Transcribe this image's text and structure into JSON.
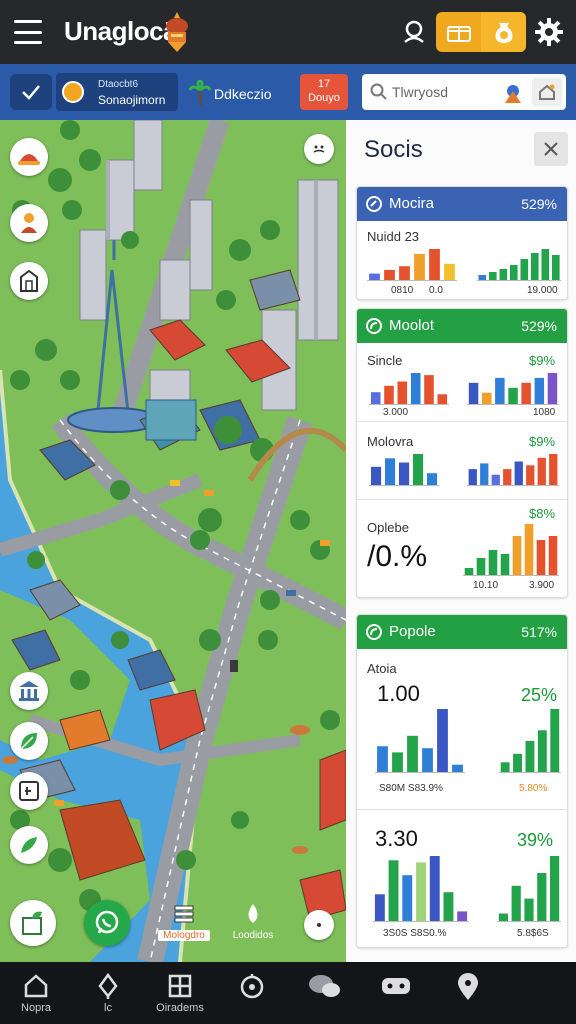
{
  "app": {
    "title": "Unaglocä"
  },
  "subbar": {
    "city_small": "Dtaocbt6",
    "city_name": "Sonaojimorn",
    "label": "Ddkeczio",
    "badge_line1": "17",
    "badge_line2": "Douyo"
  },
  "search": {
    "value": "Tlwryosd"
  },
  "map": {
    "chip1_label": "Mologdro",
    "chip2_label": "Loodidos"
  },
  "panel": {
    "title": "Socis",
    "cards": [
      {
        "name": "Mocira",
        "percent": "529%",
        "header_color": "#3a63b3",
        "rows": [
          {
            "label": "Nuidd 23",
            "axis_left": [
              "0810",
              "0.0"
            ],
            "axis_right": "19.000",
            "chart_left": [
              6,
              9,
              12,
              22,
              26,
              14
            ],
            "colors_left": [
              "#5b6ee1",
              "#e5532e",
              "#e5532e",
              "#f0a02a",
              "#e5532e",
              "#f0c02a"
            ],
            "chart_right": [
              6,
              9,
              12,
              16,
              22,
              28,
              32,
              26
            ],
            "colors_right": [
              "#2f7fd8",
              "#23a44b",
              "#23a44b",
              "#23a44b",
              "#23a44b",
              "#23a44b",
              "#23a44b",
              "#23a44b"
            ]
          }
        ]
      },
      {
        "name": "Moolot",
        "percent": "529%",
        "header_color": "#23a043",
        "rows": [
          {
            "label": "Sincle",
            "pct": "$9%",
            "axis_left": "3.000",
            "axis_right": "1080",
            "chart_left": [
              12,
              18,
              22,
              30,
              28,
              10
            ],
            "colors_left": [
              "#5b6ee1",
              "#e5532e",
              "#e5532e",
              "#2f7fd8",
              "#e5532e",
              "#e5532e"
            ],
            "chart_right": [
              18,
              10,
              22,
              14,
              18,
              22,
              26
            ],
            "colors_right": [
              "#3a57c4",
              "#f0a02a",
              "#2f7fd8",
              "#23a44b",
              "#e5532e",
              "#2f7fd8",
              "#7a55c9"
            ]
          },
          {
            "label": "Molovra",
            "pct": "$9%",
            "chart_left": [
              18,
              26,
              22,
              30,
              12
            ],
            "colors_left": [
              "#3a57c4",
              "#2f7fd8",
              "#3a57c4",
              "#23a44b",
              "#2f7fd8"
            ],
            "chart_right": [
              18,
              24,
              12,
              18,
              26,
              22,
              30,
              34
            ],
            "colors_right": [
              "#3a57c4",
              "#2f7fd8",
              "#5b6ee1",
              "#e5532e",
              "#3a57c4",
              "#e5532e",
              "#e5532e",
              "#e5532e"
            ]
          },
          {
            "label": "Oplebe",
            "pct": "$8%",
            "big": "/0.%",
            "axis_left": "10.10",
            "axis_right": "3.900",
            "chart_right": [
              8,
              18,
              26,
              22,
              40,
              52,
              36,
              40
            ],
            "colors_right": [
              "#23a44b",
              "#23a44b",
              "#23a44b",
              "#23a44b",
              "#f0a02a",
              "#f0a02a",
              "#e5532e",
              "#e5532e"
            ]
          }
        ]
      },
      {
        "name": "Popole",
        "percent": "517%",
        "header_color": "#23a043",
        "rows": [
          {
            "label": "Atoia",
            "big": "1.00",
            "pct": "25%",
            "axis_left": "S80M  S83.9%",
            "axis_right": "5.80%",
            "chart_left": [
              26,
              20,
              36,
              24,
              62,
              8
            ],
            "colors_left": [
              "#2f7fd8",
              "#23a44b",
              "#23a44b",
              "#2f7fd8",
              "#3a57c4",
              "#2f7fd8"
            ],
            "chart_right": [
              10,
              18,
              30,
              40,
              60
            ],
            "colors_right": [
              "#23a44b",
              "#23a44b",
              "#23a44b",
              "#23a44b",
              "#23a44b"
            ]
          },
          {
            "big": "3.30",
            "pct": "39%",
            "axis_left": "3S0S  S8S0.%",
            "axis_right": "5.8$6S",
            "chart_left": [
              26,
              58,
              44,
              56,
              62,
              28,
              10
            ],
            "colors_left": [
              "#3a57c4",
              "#23a44b",
              "#2f7fd8",
              "#9fd47a",
              "#3a57c4",
              "#23a44b",
              "#7a55c9"
            ],
            "chart_right": [
              8,
              34,
              22,
              46,
              62
            ],
            "colors_right": [
              "#23a44b",
              "#23a44b",
              "#23a44b",
              "#23a44b",
              "#23a44b"
            ]
          }
        ]
      }
    ]
  },
  "bottom_nav": [
    {
      "icon": "home-icon",
      "label": "Nopra"
    },
    {
      "icon": "leaf-icon",
      "label": "lc"
    },
    {
      "icon": "grid-icon",
      "label": "Oiradems"
    },
    {
      "icon": "compass-icon",
      "label": ""
    },
    {
      "icon": "chat-icon",
      "label": ""
    },
    {
      "icon": "gamepad-icon",
      "label": ""
    },
    {
      "icon": "pin-icon",
      "label": ""
    }
  ]
}
